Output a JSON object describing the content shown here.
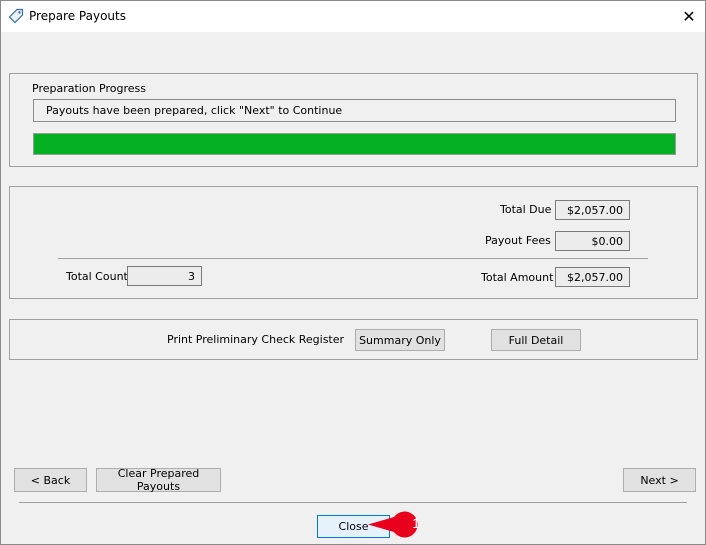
{
  "window": {
    "title": "Prepare Payouts"
  },
  "progress": {
    "group_label": "Preparation Progress",
    "status_text": "Payouts have been prepared, click \"Next\" to Continue",
    "percent": 100,
    "fill_color": "#06b025"
  },
  "totals": {
    "total_due_label": "Total Due",
    "total_due_value": "$2,057.00",
    "payout_fees_label": "Payout Fees",
    "payout_fees_value": "$0.00",
    "total_count_label": "Total Count",
    "total_count_value": "3",
    "total_amount_label": "Total Amount",
    "total_amount_value": "$2,057.00"
  },
  "register": {
    "label": "Print Preliminary Check Register",
    "summary_button": "Summary Only",
    "full_button": "Full Detail"
  },
  "footer": {
    "back_button": "< Back",
    "clear_button": "Clear Prepared Payouts",
    "next_button": "Next >",
    "close_button": "Close"
  },
  "annotation": {
    "callout_number": "1",
    "callout_color": "#e8001c"
  },
  "icons": {
    "title_icon": "tag-icon",
    "close_icon": "close-icon"
  }
}
